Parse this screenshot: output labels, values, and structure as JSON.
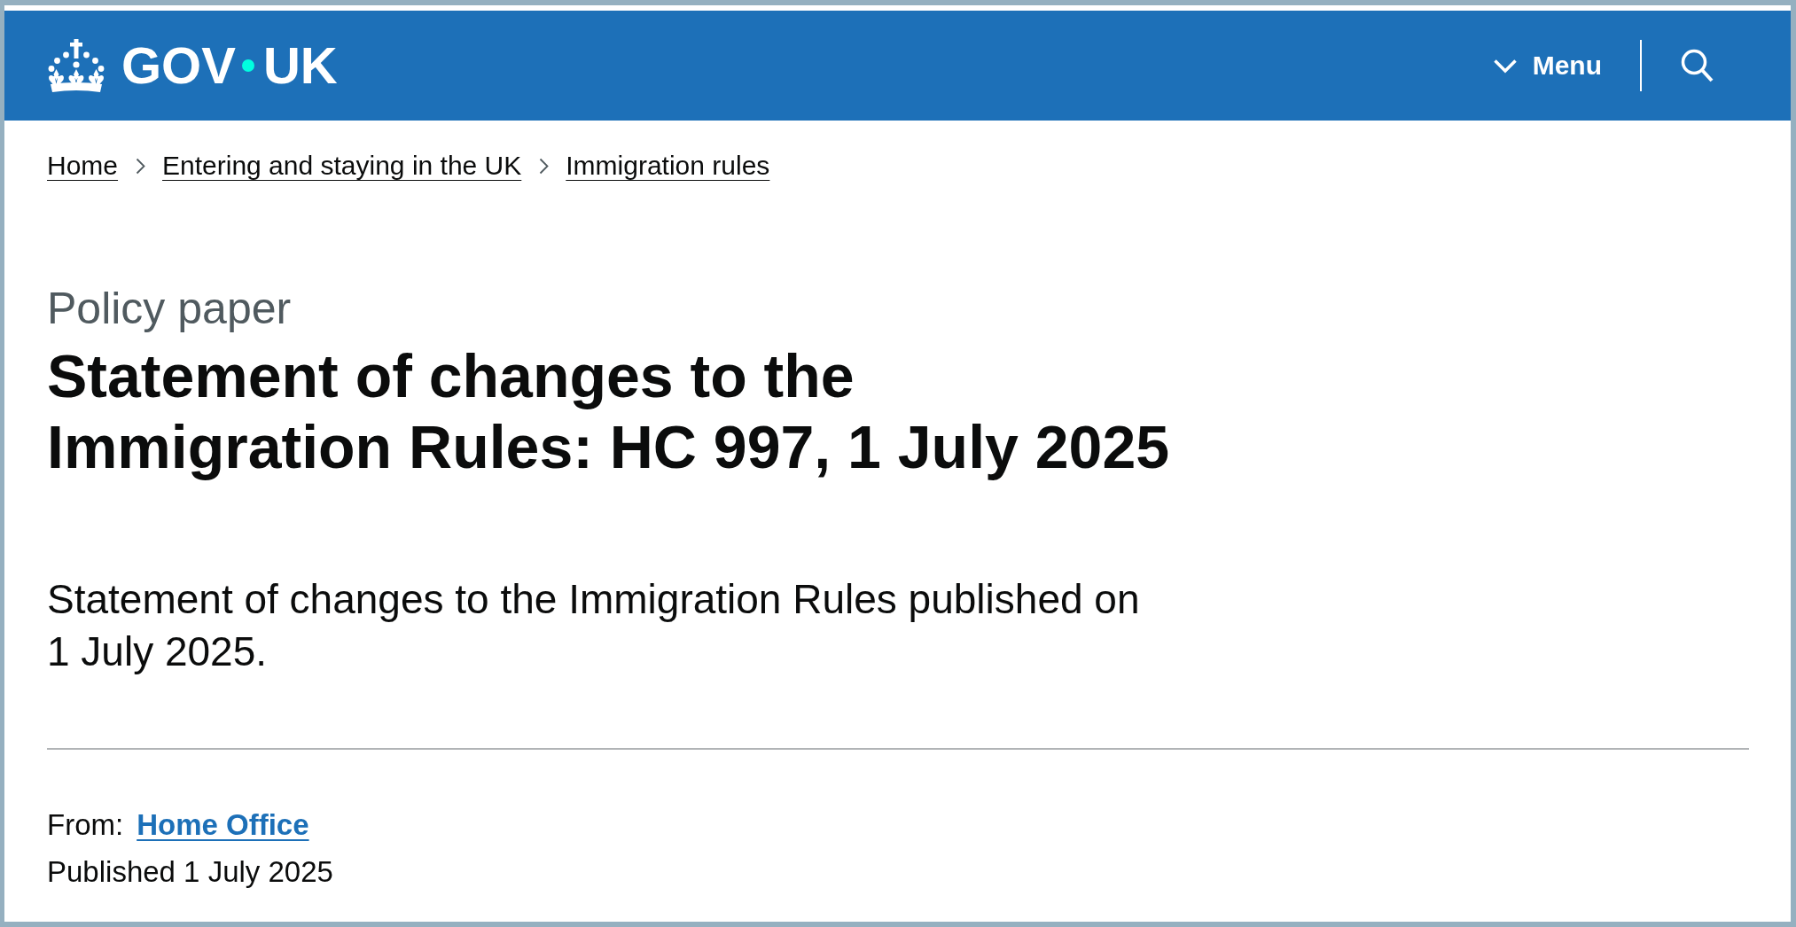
{
  "header": {
    "logo_words": [
      "GOV",
      "UK"
    ],
    "menu": {
      "label": "Menu",
      "expanded": false
    }
  },
  "breadcrumbs": [
    "Home",
    "Entering and staying in the UK",
    "Immigration rules"
  ],
  "document_type": "Policy paper",
  "title": "Statement of changes to the Immigration Rules: HC 997, 1 July 2025",
  "summary": "Statement of changes to the Immigration Rules published on 1 July 2025.",
  "metadata": {
    "from_label": "From:",
    "from_link": "Home Office",
    "published": "Published 1 July 2025"
  }
}
